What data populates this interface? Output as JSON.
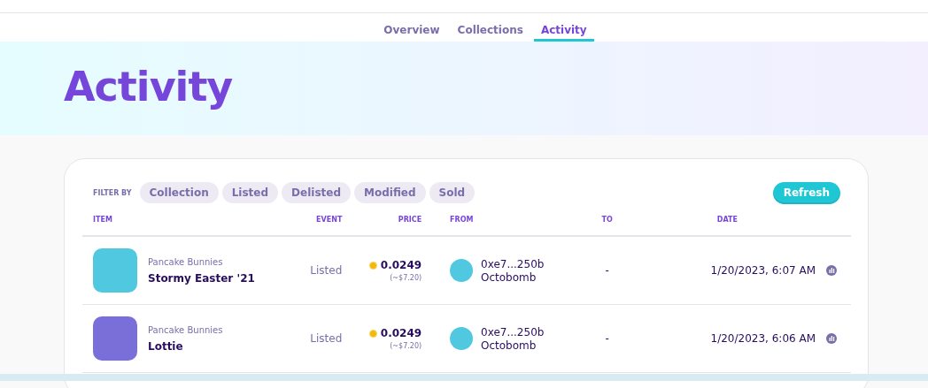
{
  "tabs": [
    {
      "label": "Overview",
      "selected": false
    },
    {
      "label": "Collections",
      "selected": false
    },
    {
      "label": "Activity",
      "selected": true
    }
  ],
  "hero": {
    "title": "Activity"
  },
  "filters": {
    "label": "FILTER BY",
    "chips": [
      "Collection",
      "Listed",
      "Delisted",
      "Modified",
      "Sold"
    ]
  },
  "refresh_button": "Refresh",
  "table": {
    "columns": [
      "ITEM",
      "EVENT",
      "PRICE",
      "FROM",
      "TO",
      "DATE"
    ],
    "rows": [
      {
        "collection": "Pancake Bunnies",
        "name": "Stormy Easter '21",
        "event": "Listed",
        "price": "0.0249",
        "usd": "(~$7.20)",
        "from_address": "0xe7...250b",
        "from_name": "Octobomb",
        "to": "-",
        "date": "1/20/2023, 6:07 AM",
        "color": "#4fc8e0"
      },
      {
        "collection": "Pancake Bunnies",
        "name": "Lottie",
        "event": "Listed",
        "price": "0.0249",
        "usd": "(~$7.20)",
        "from_address": "0xe7...250b",
        "from_name": "Octobomb",
        "to": "-",
        "date": "1/20/2023, 6:06 AM",
        "color": "#7a6fd8"
      }
    ]
  }
}
